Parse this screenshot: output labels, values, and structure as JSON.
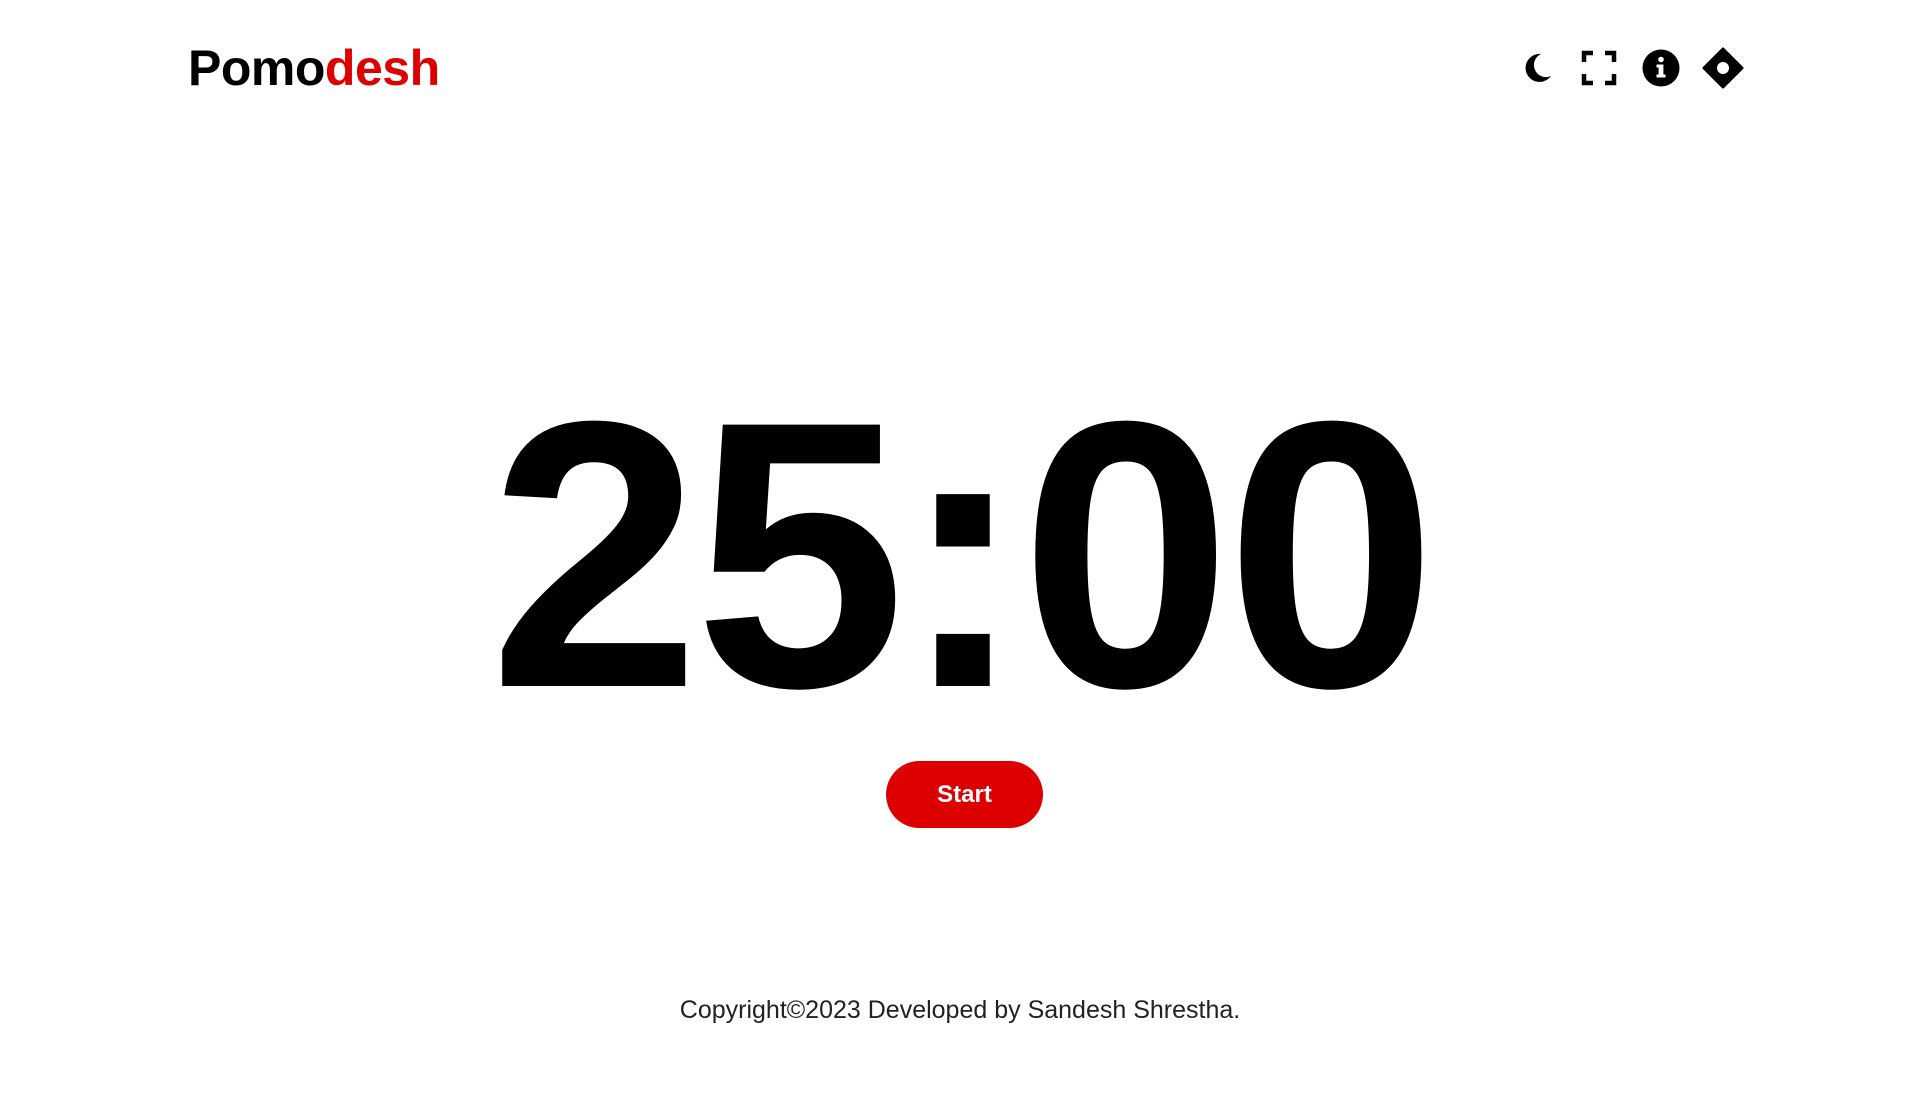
{
  "header": {
    "brand_part1": "Pomo",
    "brand_part2": "desh",
    "icons": [
      "moon-icon",
      "fullscreen-icon",
      "info-icon",
      "settings-icon"
    ]
  },
  "timer": {
    "display": "25:00"
  },
  "controls": {
    "start_label": "Start"
  },
  "footer": {
    "copyright": "Copyright©2023 Developed by Sandesh Shrestha."
  },
  "colors": {
    "accent": "#dd0000",
    "text": "#000000",
    "background": "#ffffff"
  }
}
